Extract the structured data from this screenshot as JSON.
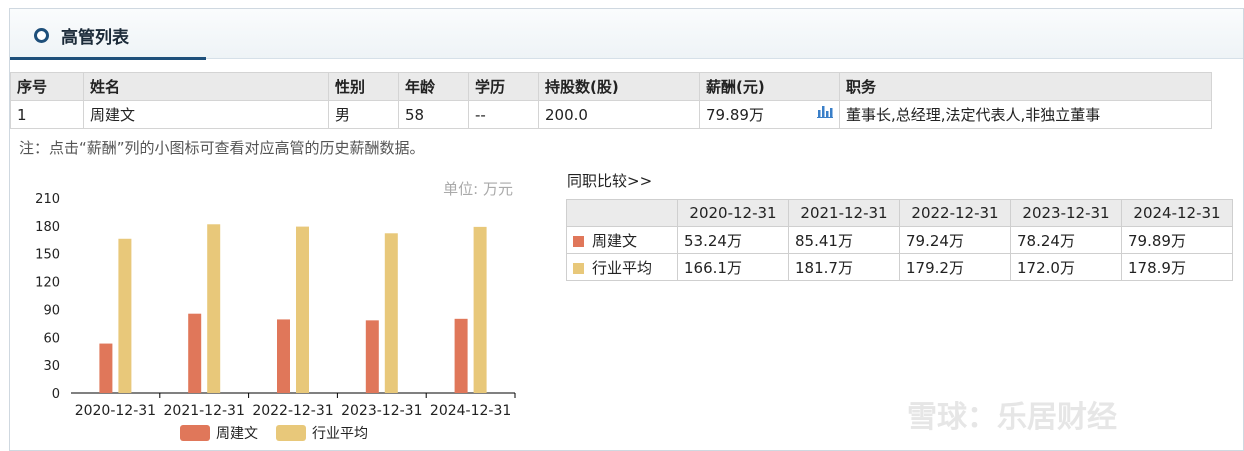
{
  "header": {
    "title": "高管列表"
  },
  "exec_table": {
    "columns": [
      "序号",
      "姓名",
      "性别",
      "年龄",
      "学历",
      "持股数(股)",
      "薪酬(元)",
      "职务"
    ],
    "rows": [
      [
        "1",
        "周建文",
        "男",
        "58",
        "--",
        "200.0",
        "79.89万",
        "董事长,总经理,法定代表人,非独立董事"
      ]
    ],
    "chart_icon": "bar-chart-icon"
  },
  "note": "注：点击“薪酬”列的小图标可查看对应高管的历史薪酬数据。",
  "compare": {
    "link_label": "同职比较>>",
    "headers": [
      "",
      "2020-12-31",
      "2021-12-31",
      "2022-12-31",
      "2023-12-31",
      "2024-12-31"
    ],
    "rows": [
      {
        "name": "周建文",
        "color": "#e0775a",
        "values": [
          "53.24万",
          "85.41万",
          "79.24万",
          "78.24万",
          "79.89万"
        ]
      },
      {
        "name": "行业平均",
        "color": "#e8c87a",
        "values": [
          "166.1万",
          "181.7万",
          "179.2万",
          "172.0万",
          "178.9万"
        ]
      }
    ]
  },
  "chart_data": {
    "type": "bar",
    "unit_label": "单位: 万元",
    "categories": [
      "2020-12-31",
      "2021-12-31",
      "2022-12-31",
      "2023-12-31",
      "2024-12-31"
    ],
    "series": [
      {
        "name": "周建文",
        "color": "#e0775a",
        "values": [
          53.24,
          85.41,
          79.24,
          78.24,
          79.89
        ]
      },
      {
        "name": "行业平均",
        "color": "#e8c87a",
        "values": [
          166.1,
          181.7,
          179.2,
          172.0,
          178.9
        ]
      }
    ],
    "yticks": [
      "0",
      "30",
      "60",
      "90",
      "120",
      "150",
      "180",
      "210"
    ],
    "ylim": [
      0,
      210
    ],
    "legend_position": "bottom"
  },
  "watermark": "雪球：乐居财经"
}
